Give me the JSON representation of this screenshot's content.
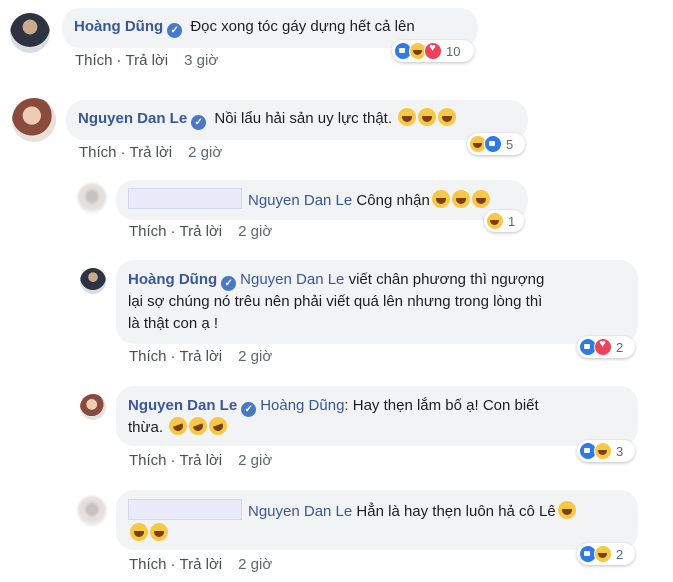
{
  "actions": {
    "like": "Thích",
    "reply": "Trả lời",
    "sep": "·"
  },
  "comments": [
    {
      "author": "Hoàng Dũng",
      "text": "Đọc xong tóc gáy dựng hết cả lên",
      "time": "3 giờ",
      "reaction_count": "10",
      "reactions": [
        "like-icon",
        "haha-icon",
        "love-icon"
      ]
    },
    {
      "author": "Nguyen Dan Le",
      "text": "Nồi lẩu hải sản uy lực thật.",
      "time": "2 giờ",
      "reaction_count": "5",
      "reactions": [
        "haha-icon",
        "like-icon"
      ]
    },
    {
      "author": "",
      "mention": "Nguyen Dan Le",
      "text": "Công nhận",
      "time": "2 giờ",
      "reaction_count": "1",
      "reactions": [
        "haha-icon"
      ]
    },
    {
      "author": "Hoàng Dũng",
      "mention": "Nguyen Dan Le",
      "text_l1": "viết chân phương thì ngượng",
      "text_l2": "lại sợ chúng nó trêu nên phải viết quá lên nhưng trong lòng thì",
      "text_l3": "là thật con ạ !",
      "time": "2 giờ",
      "reaction_count": "2",
      "reactions": [
        "like-icon",
        "love-icon"
      ]
    },
    {
      "author": "Nguyen Dan Le",
      "mention": "Hoàng Dũng",
      "text_l1": ": Hay thẹn lắm bố ạ! Con biết",
      "text_l2": "thừa.",
      "time": "2 giờ",
      "reaction_count": "3",
      "reactions": [
        "like-icon",
        "haha-icon"
      ]
    },
    {
      "author": "",
      "mention": "Nguyen Dan Le",
      "text": "Hẳn là hay thẹn luôn hả cô Lê",
      "time": "2 giờ",
      "reaction_count": "2",
      "reactions": [
        "like-icon",
        "haha-icon"
      ]
    }
  ]
}
